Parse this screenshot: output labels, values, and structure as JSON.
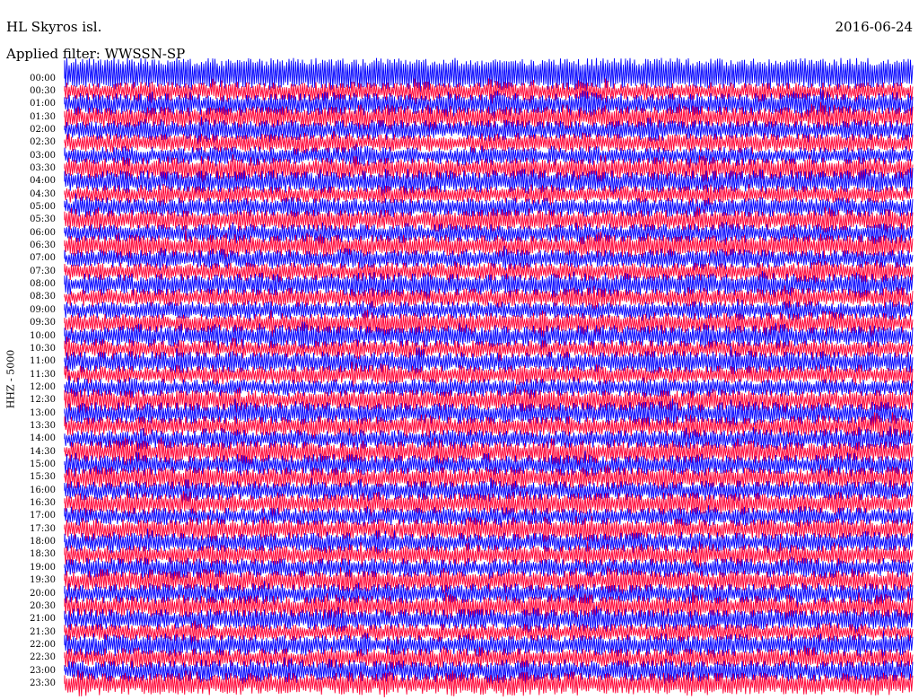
{
  "header": {
    "station": "HL Skyros isl.",
    "date": "2016-06-24",
    "filter_label": "Applied filter: WWSSN-SP"
  },
  "chart_data": {
    "type": "line",
    "title": "",
    "ylabel": "HHZ - 5000",
    "xlabel": "",
    "rows": [
      "00:00",
      "00:30",
      "01:00",
      "01:30",
      "02:00",
      "02:30",
      "03:00",
      "03:30",
      "04:00",
      "04:30",
      "05:00",
      "05:30",
      "06:00",
      "06:30",
      "07:00",
      "07:30",
      "08:00",
      "08:30",
      "09:00",
      "09:30",
      "10:00",
      "10:30",
      "11:00",
      "11:30",
      "12:00",
      "12:30",
      "13:00",
      "13:30",
      "14:00",
      "14:30",
      "15:00",
      "15:30",
      "16:00",
      "16:30",
      "17:00",
      "17:30",
      "18:00",
      "18:30",
      "19:00",
      "19:30",
      "20:00",
      "20:30",
      "21:00",
      "21:30",
      "22:00",
      "22:30",
      "23:00",
      "23:30"
    ],
    "trace_colors": [
      "#0000ff",
      "#ff0033"
    ],
    "grid": false
  }
}
